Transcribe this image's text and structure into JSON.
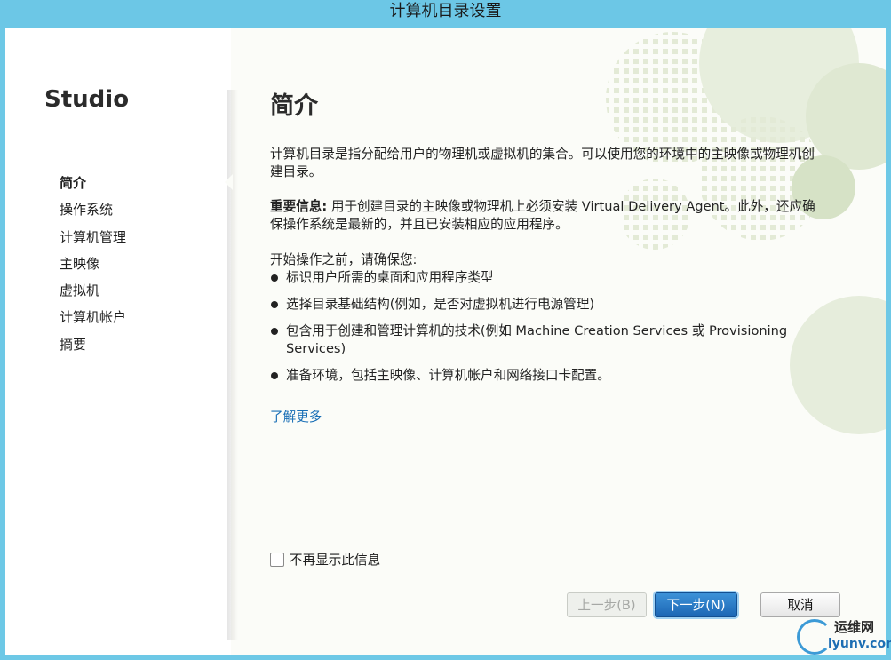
{
  "window": {
    "title": "计算机目录设置"
  },
  "sidebar": {
    "brand": "Studio",
    "items": [
      {
        "label": "简介",
        "active": true
      },
      {
        "label": "操作系统",
        "active": false
      },
      {
        "label": "计算机管理",
        "active": false
      },
      {
        "label": "主映像",
        "active": false
      },
      {
        "label": "虚拟机",
        "active": false
      },
      {
        "label": "计算机帐户",
        "active": false
      },
      {
        "label": "摘要",
        "active": false
      }
    ]
  },
  "content": {
    "heading": "简介",
    "intro": "计算机目录是指分配给用户的物理机或虚拟机的集合。可以使用您的环境中的主映像或物理机创建目录。",
    "important_label": "重要信息:",
    "important_text": " 用于创建目录的主映像或物理机上必须安装 Virtual Delivery Agent。此外，还应确保操作系统是最新的，并且已安装相应的应用程序。",
    "before_start": "开始操作之前，请确保您:",
    "bullets": [
      "标识用户所需的桌面和应用程序类型",
      "选择目录基础结构(例如，是否对虚拟机进行电源管理)",
      "包含用于创建和管理计算机的技术(例如 Machine Creation Services 或 Provisioning Services)",
      "准备环境，包括主映像、计算机帐户和网络接口卡配置。"
    ],
    "learn_more": "了解更多"
  },
  "footer": {
    "dont_show_label": "不再显示此信息",
    "dont_show_checked": false,
    "back_label": "上一步(B)",
    "next_label": "下一步(N)",
    "cancel_label": "取消"
  },
  "watermark": {
    "top": "运维网",
    "bottom": "iyunv.com"
  },
  "colors": {
    "title_bar": "#6cc7e6",
    "accent": "#1c66b4",
    "link": "#1a6fb6"
  }
}
